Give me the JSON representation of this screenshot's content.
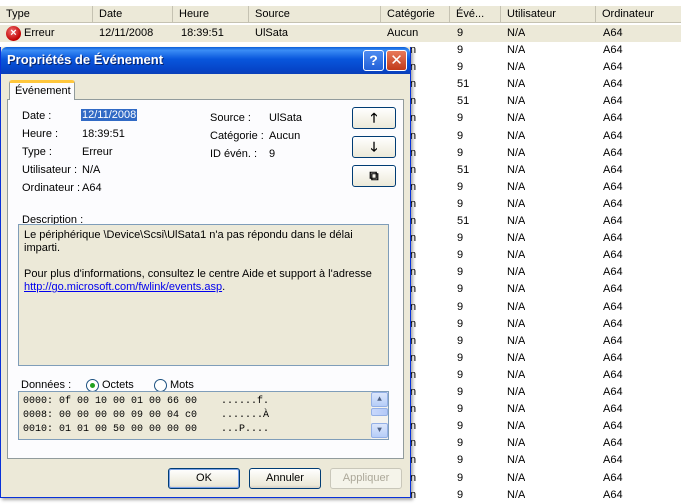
{
  "list": {
    "columns": [
      {
        "label": "Type"
      },
      {
        "label": "Date"
      },
      {
        "label": "Heure"
      },
      {
        "label": "Source"
      },
      {
        "label": "Catégorie"
      },
      {
        "label": "Évé..."
      },
      {
        "label": "Utilisateur"
      },
      {
        "label": "Ordinateur"
      }
    ],
    "first_row": {
      "type": "Erreur",
      "date": "12/11/2008",
      "time": "18:39:51",
      "source": "UlSata",
      "category": "Aucun",
      "event_id": "9",
      "user": "N/A",
      "computer": "A64"
    },
    "category_fragment": "n",
    "rows": [
      {
        "event_id": "9",
        "user": "N/A",
        "computer": "A64"
      },
      {
        "event_id": "9",
        "user": "N/A",
        "computer": "A64"
      },
      {
        "event_id": "51",
        "user": "N/A",
        "computer": "A64"
      },
      {
        "event_id": "51",
        "user": "N/A",
        "computer": "A64"
      },
      {
        "event_id": "9",
        "user": "N/A",
        "computer": "A64"
      },
      {
        "event_id": "9",
        "user": "N/A",
        "computer": "A64"
      },
      {
        "event_id": "9",
        "user": "N/A",
        "computer": "A64"
      },
      {
        "event_id": "51",
        "user": "N/A",
        "computer": "A64"
      },
      {
        "event_id": "9",
        "user": "N/A",
        "computer": "A64"
      },
      {
        "event_id": "9",
        "user": "N/A",
        "computer": "A64"
      },
      {
        "event_id": "51",
        "user": "N/A",
        "computer": "A64"
      },
      {
        "event_id": "9",
        "user": "N/A",
        "computer": "A64"
      },
      {
        "event_id": "9",
        "user": "N/A",
        "computer": "A64"
      },
      {
        "event_id": "9",
        "user": "N/A",
        "computer": "A64"
      },
      {
        "event_id": "9",
        "user": "N/A",
        "computer": "A64"
      },
      {
        "event_id": "9",
        "user": "N/A",
        "computer": "A64"
      },
      {
        "event_id": "9",
        "user": "N/A",
        "computer": "A64"
      },
      {
        "event_id": "9",
        "user": "N/A",
        "computer": "A64"
      },
      {
        "event_id": "9",
        "user": "N/A",
        "computer": "A64"
      },
      {
        "event_id": "9",
        "user": "N/A",
        "computer": "A64"
      },
      {
        "event_id": "9",
        "user": "N/A",
        "computer": "A64"
      },
      {
        "event_id": "9",
        "user": "N/A",
        "computer": "A64"
      },
      {
        "event_id": "9",
        "user": "N/A",
        "computer": "A64"
      },
      {
        "event_id": "9",
        "user": "N/A",
        "computer": "A64"
      },
      {
        "event_id": "9",
        "user": "N/A",
        "computer": "A64"
      },
      {
        "event_id": "9",
        "user": "N/A",
        "computer": "A64"
      },
      {
        "event_id": "9",
        "user": "N/A",
        "computer": "A64"
      }
    ]
  },
  "dialog": {
    "title": "Propriétés de Événement",
    "help_glyph": "?",
    "close_glyph": "✕",
    "tab_label": "Événement",
    "fields": {
      "date_label": "Date :",
      "date_value": "12/11/2008",
      "time_label": "Heure :",
      "time_value": "18:39:51",
      "type_label": "Type :",
      "type_value": "Erreur",
      "user_label": "Utilisateur :",
      "user_value": "N/A",
      "computer_label": "Ordinateur :",
      "computer_value": "A64",
      "source_label": "Source :",
      "source_value": "UlSata",
      "category_label": "Catégorie :",
      "category_value": "Aucun",
      "id_label": "ID évén. :",
      "id_value": "9"
    },
    "nav": {
      "up_glyph": "🡑",
      "down_glyph": "🡓",
      "copy_glyph": "⧉"
    },
    "description_label": "Description :",
    "description_line1": "Le périphérique \\Device\\Scsi\\UlSata1 n'a pas répondu dans le délai imparti.",
    "description_line2": "Pour plus d'informations, consultez le centre Aide et support à l'adresse",
    "description_link": "http://go.microsoft.com/fwlink/events.asp",
    "description_link_suffix": ".",
    "data_label": "Données :",
    "radio_bytes": "Octets",
    "radio_words": "Mots",
    "radio_selected": "Octets",
    "hex_lines": [
      "0000: 0f 00 10 00 01 00 66 00    ......f.",
      "0008: 00 00 00 00 09 00 04 c0    .......À",
      "0010: 01 01 00 50 00 00 00 00    ...P...."
    ],
    "buttons": {
      "ok": "OK",
      "cancel": "Annuler",
      "apply": "Appliquer"
    }
  }
}
